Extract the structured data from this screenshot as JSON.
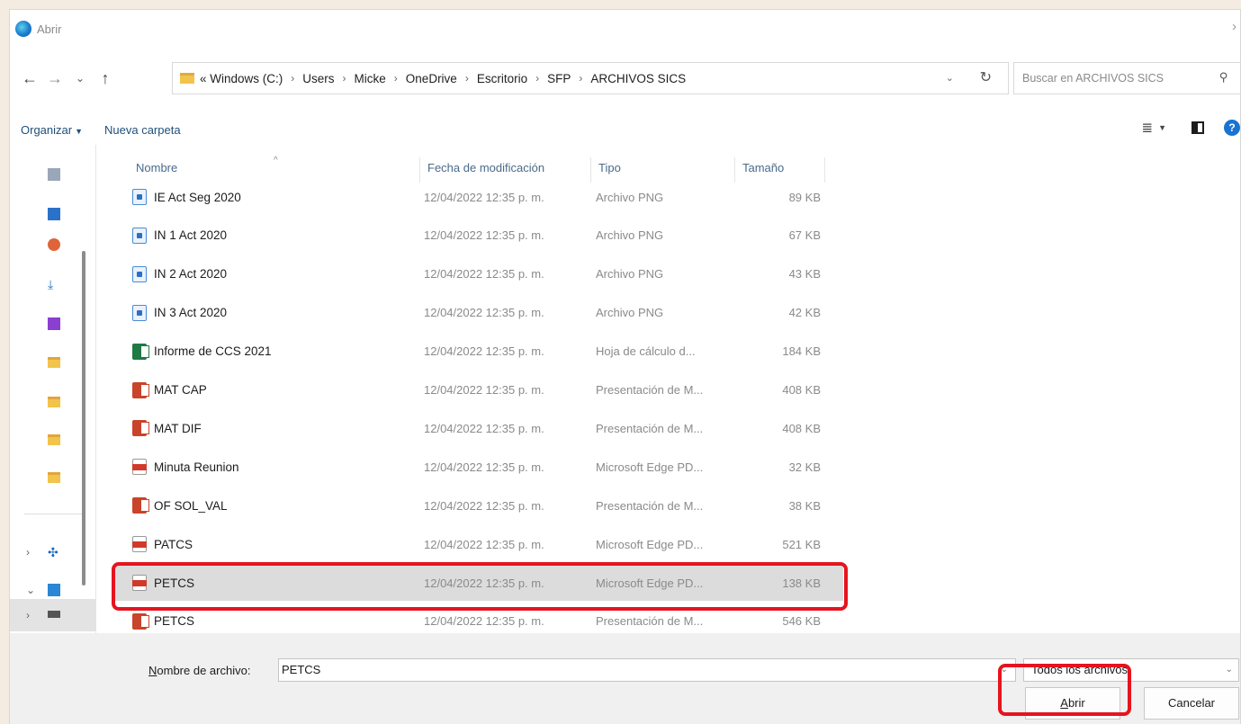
{
  "window": {
    "title": "Abrir"
  },
  "address": {
    "crumbs": [
      "« Windows (C:)",
      "Users",
      "Micke",
      "OneDrive",
      "Escritorio",
      "SFP",
      "ARCHIVOS SICS"
    ]
  },
  "search": {
    "placeholder": "Buscar en ARCHIVOS SICS"
  },
  "toolbar": {
    "organize": "Organizar",
    "new_folder": "Nueva carpeta"
  },
  "columns": {
    "name": "Nombre",
    "date": "Fecha de modificación",
    "type": "Tipo",
    "size": "Tamaño"
  },
  "files": [
    {
      "icon": "png-file-icon",
      "name": "IE Act Seg 2020",
      "date": "12/04/2022 12:35 p. m.",
      "type": "Archivo PNG",
      "size": "89 KB"
    },
    {
      "icon": "png-file-icon",
      "name": "IN 1 Act 2020",
      "date": "12/04/2022 12:35 p. m.",
      "type": "Archivo PNG",
      "size": "67 KB"
    },
    {
      "icon": "png-file-icon",
      "name": "IN 2 Act 2020",
      "date": "12/04/2022 12:35 p. m.",
      "type": "Archivo PNG",
      "size": "43 KB"
    },
    {
      "icon": "png-file-icon",
      "name": "IN 3 Act 2020",
      "date": "12/04/2022 12:35 p. m.",
      "type": "Archivo PNG",
      "size": "42 KB"
    },
    {
      "icon": "excel-file-icon",
      "name": "Informe de CCS 2021",
      "date": "12/04/2022 12:35 p. m.",
      "type": "Hoja de cálculo d...",
      "size": "184 KB"
    },
    {
      "icon": "powerpoint-file-icon",
      "name": "MAT CAP",
      "date": "12/04/2022 12:35 p. m.",
      "type": "Presentación de M...",
      "size": "408 KB"
    },
    {
      "icon": "powerpoint-file-icon",
      "name": "MAT DIF",
      "date": "12/04/2022 12:35 p. m.",
      "type": "Presentación de M...",
      "size": "408 KB"
    },
    {
      "icon": "pdf-file-icon",
      "name": "Minuta Reunion",
      "date": "12/04/2022 12:35 p. m.",
      "type": "Microsoft Edge PD...",
      "size": "32 KB"
    },
    {
      "icon": "powerpoint-file-icon",
      "name": "OF SOL_VAL",
      "date": "12/04/2022 12:35 p. m.",
      "type": "Presentación de M...",
      "size": "38 KB"
    },
    {
      "icon": "pdf-file-icon",
      "name": "PATCS",
      "date": "12/04/2022 12:35 p. m.",
      "type": "Microsoft Edge PD...",
      "size": "521 KB"
    },
    {
      "icon": "pdf-file-icon",
      "name": "PETCS",
      "date": "12/04/2022 12:35 p. m.",
      "type": "Microsoft Edge PD...",
      "size": "138 KB",
      "selected": true
    },
    {
      "icon": "powerpoint-file-icon",
      "name": "PETCS",
      "date": "12/04/2022 12:35 p. m.",
      "type": "Presentación de M...",
      "size": "546 KB"
    }
  ],
  "footer": {
    "filename_label_u": "N",
    "filename_label_rest": "ombre de archivo:",
    "filename_value": "PETCS",
    "filetype": "Todos los archivos",
    "open_u": "A",
    "open_rest": "brir",
    "cancel": "Cancelar"
  },
  "colors": {
    "highlight": "#e5141f",
    "selected_row": "#dcdcdc",
    "link": "#1f4f7a"
  }
}
